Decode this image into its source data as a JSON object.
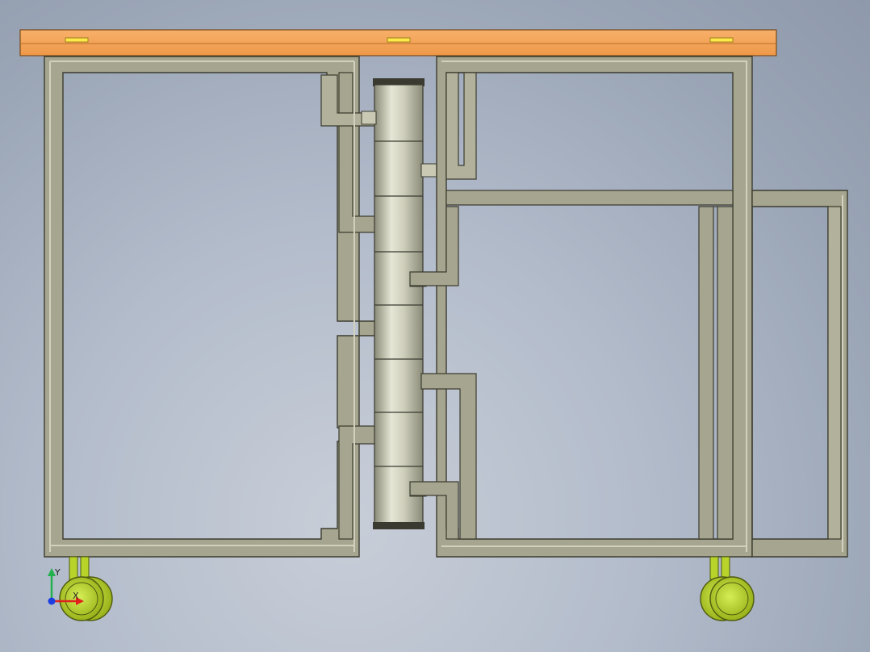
{
  "view": {
    "background_top": "#8e99ab",
    "background_bottom": "#c8ced8"
  },
  "colors": {
    "tube_fill": "#a6a58f",
    "tube_edge": "#3c3c30",
    "tube_highlight": "#d2d1bd",
    "plate_fill": "#f6a55a",
    "plate_edge": "#7a4a1c",
    "slot_fill": "#ffe94a",
    "wheel_fill": "#b8d42a",
    "wheel_edge": "#4e5a10",
    "hinge_fill": "#c9c9b4",
    "hinge_edge": "#3a3a30"
  },
  "triad": {
    "x_label": "X",
    "y_label": "Y",
    "x_color": "#e0201c",
    "y_color": "#23b14d",
    "z_color": "#1c3ee0"
  },
  "icons": {
    "triad": "coordinate-triad-icon"
  }
}
